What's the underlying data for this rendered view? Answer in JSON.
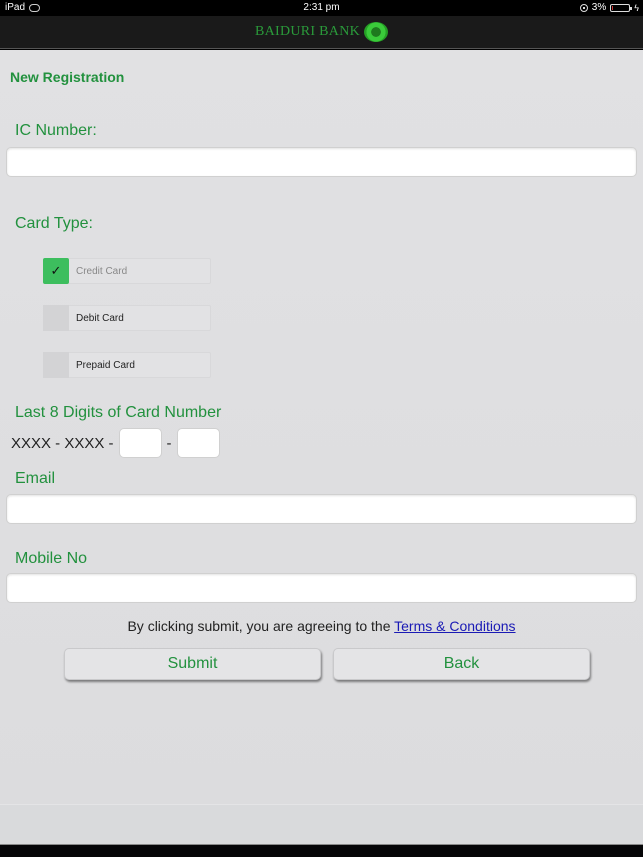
{
  "status_bar": {
    "device": "iPad",
    "time": "2:31 pm",
    "battery_percent": "3%",
    "battery_level": 0.03
  },
  "header": {
    "brand": "BAIDURI BANK",
    "logo_icon": "baiduri-logo-icon"
  },
  "page": {
    "title": "New Registration"
  },
  "form": {
    "ic_number": {
      "label": "IC Number:",
      "value": ""
    },
    "card_type": {
      "label": "Card Type:",
      "options": [
        {
          "label": "Credit Card",
          "checked": true
        },
        {
          "label": "Debit Card",
          "checked": false
        },
        {
          "label": "Prepaid Card",
          "checked": false
        }
      ],
      "check_glyph": "✓"
    },
    "card_digits": {
      "label": "Last 8 Digits of Card Number",
      "prefix": "XXXX - XXXX -",
      "separator": "-",
      "part1": "",
      "part2": ""
    },
    "email": {
      "label": "Email",
      "value": ""
    },
    "mobile": {
      "label": "Mobile No",
      "value": ""
    }
  },
  "agreement": {
    "text": "By clicking submit, you are agreeing to the ",
    "link": "Terms & Conditions"
  },
  "buttons": {
    "submit": "Submit",
    "back": "Back"
  },
  "colors": {
    "accent": "#22913e",
    "check": "#3dbe5e",
    "link": "#1a1ab5"
  }
}
